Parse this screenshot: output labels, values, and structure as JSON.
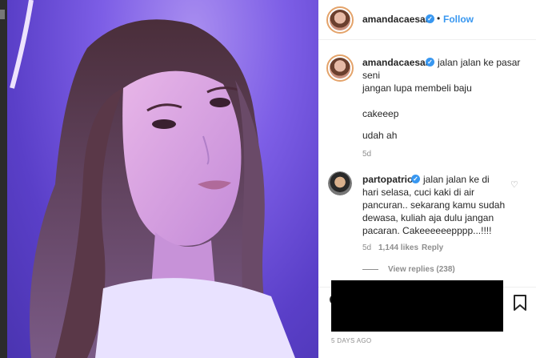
{
  "post": {
    "author": "amandacaesaa",
    "follow_label": "Follow",
    "dot": "•",
    "caption_user": "amandacaesaa",
    "caption_line1": "jalan jalan ke pasar",
    "caption_line2": "seni",
    "caption_line3": "jangan lupa membeli baju",
    "caption_line4": "cakeeep",
    "caption_line5": "udah ah",
    "caption_age": "5d",
    "date": "5 DAYS AGO"
  },
  "comment": {
    "user": "partopatrio",
    "line1": "jalan jalan ke di",
    "line2": "hari selasa, cuci kaki di air",
    "line3": "pancuran.. sekarang kamu sudah",
    "line4": "dewasa, kuliah aja dulu jangan",
    "line5": "pacaran. Cakeeeeeepppp...!!!!",
    "age": "5d",
    "likes": "1,144 likes",
    "reply_label": "Reply",
    "view_replies": "View replies (238)"
  },
  "icons": {
    "verified": "verified-badge-icon",
    "heart": "heart-icon",
    "comment": "comment-icon",
    "bookmark": "bookmark-icon"
  },
  "colors": {
    "link": "#3897f0",
    "photo_light": "#7d5ee6"
  }
}
